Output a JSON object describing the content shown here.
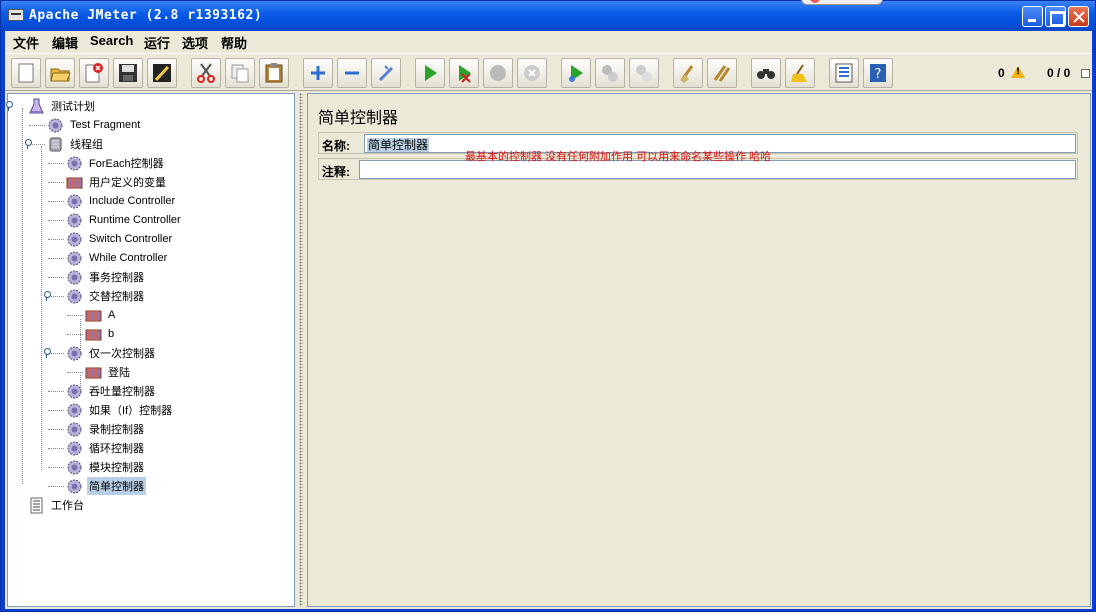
{
  "window": {
    "title": "Apache JMeter (2.8 r1393162)"
  },
  "menu": [
    "文件",
    "编辑",
    "Search",
    "运行",
    "选项",
    "帮助"
  ],
  "toolbar": {
    "buttons": [
      "new-icon",
      "open-icon",
      "close-file-icon",
      "save-icon",
      "save-as-icon",
      "cut-icon",
      "copy-icon",
      "paste-icon",
      "expand-icon",
      "collapse-icon",
      "toggle-icon",
      "start-icon",
      "start-no-pause-icon",
      "stop-icon",
      "shutdown-icon",
      "remote-start-icon",
      "remote-stop-icon",
      "remote-shutdown-icon",
      "clear-icon",
      "clear-all-icon",
      "search-icon",
      "reset-search-icon",
      "function-helper-icon",
      "help-icon"
    ],
    "error_count": "0",
    "thread_count": "0 / 0"
  },
  "tree": {
    "nodes": [
      {
        "label": "测试计划",
        "type": "plan"
      },
      {
        "label": "Test Fragment",
        "type": "controller"
      },
      {
        "label": "线程组",
        "type": "threadgroup"
      },
      {
        "label": "ForEach控制器",
        "type": "controller"
      },
      {
        "label": "用户定义的变量",
        "type": "config"
      },
      {
        "label": "Include Controller",
        "type": "controller"
      },
      {
        "label": "Runtime Controller",
        "type": "controller"
      },
      {
        "label": "Switch Controller",
        "type": "controller"
      },
      {
        "label": "While Controller",
        "type": "controller"
      },
      {
        "label": "事务控制器",
        "type": "controller"
      },
      {
        "label": "交替控制器",
        "type": "controller"
      },
      {
        "label": "A",
        "type": "config"
      },
      {
        "label": "b",
        "type": "config"
      },
      {
        "label": "仅一次控制器",
        "type": "controller"
      },
      {
        "label": "登陆",
        "type": "config"
      },
      {
        "label": "吞吐量控制器",
        "type": "controller"
      },
      {
        "label": "如果（If）控制器",
        "type": "controller"
      },
      {
        "label": "录制控制器",
        "type": "controller"
      },
      {
        "label": "循环控制器",
        "type": "controller"
      },
      {
        "label": "模块控制器",
        "type": "controller"
      },
      {
        "label": "简单控制器",
        "type": "controller",
        "selected": true
      },
      {
        "label": "工作台",
        "type": "workbench"
      }
    ]
  },
  "panel": {
    "title": "简单控制器",
    "name_label": "名称:",
    "name_value": "简单控制器",
    "comment_label": "注释:",
    "comment_value": "",
    "annotation": "最基本的控制器    没有任何附加作用    可以用来命名某些操作  哈哈"
  },
  "colors": {
    "title_bar": "#0a5ce8",
    "selection": "#b8cfe5",
    "annotation_text": "#dd1111",
    "chrome": "#ece9d8"
  }
}
